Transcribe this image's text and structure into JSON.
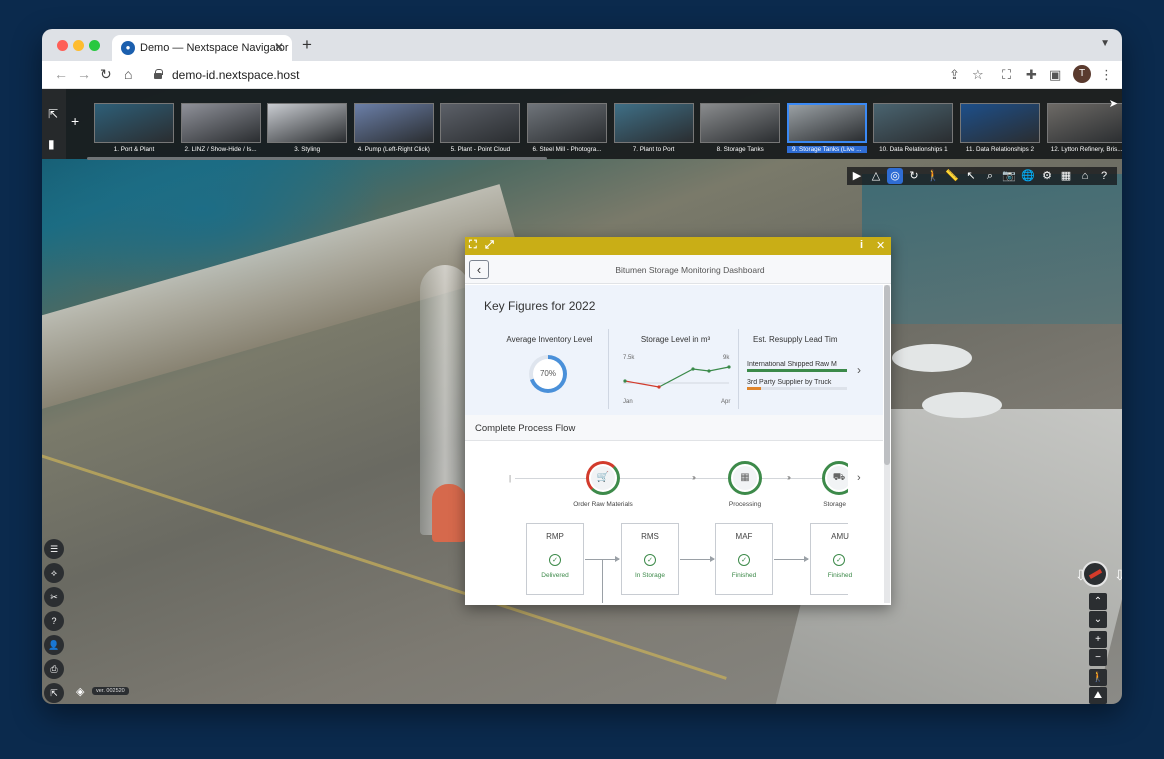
{
  "browser": {
    "tab_title": "Demo — Nextspace Navigator",
    "url": "demo-id.nextspace.host",
    "profile_initial": "T"
  },
  "scenes": [
    {
      "label": "1. Port & Plant",
      "color": "#2e5f78"
    },
    {
      "label": "2. LINZ / Show-Hide / Is...",
      "color": "#8f9199"
    },
    {
      "label": "3. Styling",
      "color": "#c9ccd1"
    },
    {
      "label": "4. Pump (Left-Right Click)",
      "color": "#6b7fa8"
    },
    {
      "label": "5. Plant - Point Cloud",
      "color": "#5c6068"
    },
    {
      "label": "6. Steel Mill - Photogra...",
      "color": "#6f747a"
    },
    {
      "label": "7. Plant to Port",
      "color": "#3f6f86"
    },
    {
      "label": "8. Storage Tanks",
      "color": "#8a8c8e"
    },
    {
      "label": "9. Storage Tanks (Live ...",
      "color": "#9aa0a4",
      "active": true
    },
    {
      "label": "10. Data Relationships 1",
      "color": "#4a6470"
    },
    {
      "label": "11. Data Relationships 2",
      "color": "#1d4f8a"
    },
    {
      "label": "12. Lytton Refinery, Bris...",
      "color": "#6d6a66"
    }
  ],
  "dashboard": {
    "title": "Bitumen Storage Monitoring Dashboard",
    "key_figures_title": "Key Figures for 2022",
    "kpi_inventory": {
      "title": "Average Inventory Level",
      "value": 0.7,
      "label": "70%"
    },
    "kpi_storage": {
      "title": "Storage Level in m³",
      "start_value": "7.5k",
      "end_value": "9k",
      "start_month": "Jan",
      "end_month": "Apr"
    },
    "kpi_resupply": {
      "title": "Est. Resupply Lead Tim",
      "bars": [
        {
          "label": "International Shipped Raw M",
          "fraction": 1.0,
          "color": "#3b8a4a"
        },
        {
          "label": "3rd Party Supplier by Truck",
          "fraction": 0.14,
          "color": "#e0852b"
        }
      ]
    },
    "process_flow_title": "Complete Process Flow",
    "steps": [
      {
        "label": "Order Raw Materials",
        "icon": "cart-icon",
        "glyph": "🛒"
      },
      {
        "label": "Processing",
        "icon": "factory-icon",
        "glyph": "▦"
      },
      {
        "label": "Storage",
        "icon": "truck-icon",
        "glyph": "⛟"
      }
    ],
    "nodes": [
      {
        "code": "RMP",
        "status": "Delivered"
      },
      {
        "code": "RMS",
        "status": "In Storage"
      },
      {
        "code": "MAF",
        "status": "Finished"
      },
      {
        "code": "AMU",
        "status": "Finished"
      }
    ]
  },
  "map": {
    "version_label": "ver. 002520"
  }
}
